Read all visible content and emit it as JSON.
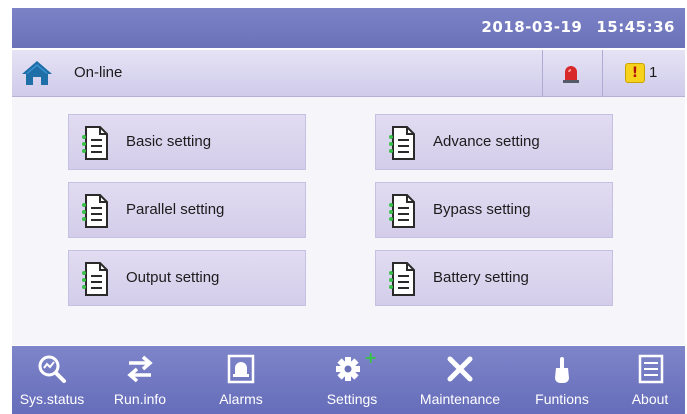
{
  "topbar": {
    "date": "2018-03-19",
    "time": "15:45:36"
  },
  "status": {
    "mode": "On-line",
    "warning_count": "1",
    "warning_symbol": "!"
  },
  "settings_menu": [
    {
      "label": "Basic setting"
    },
    {
      "label": "Advance setting"
    },
    {
      "label": "Parallel setting"
    },
    {
      "label": "Bypass setting"
    },
    {
      "label": "Output setting"
    },
    {
      "label": "Battery setting"
    }
  ],
  "bottom_nav": [
    {
      "label": "Sys.status",
      "icon": "magnifier-chart-icon"
    },
    {
      "label": "Run.info",
      "icon": "swap-arrows-icon"
    },
    {
      "label": "Alarms",
      "icon": "bell-icon"
    },
    {
      "label": "Settings",
      "icon": "gear-icon"
    },
    {
      "label": "Maintenance",
      "icon": "tools-icon"
    },
    {
      "label": "Funtions",
      "icon": "hand-pointer-icon"
    },
    {
      "label": "About",
      "icon": "document-icon"
    }
  ],
  "colors": {
    "topbar": "#6b72b8",
    "statusbar": "#d8d4ee",
    "menu_button": "#d8d2ee",
    "accent_green": "#39c24a",
    "alarm_red": "#d8282a",
    "warning_yellow": "#f7d21c"
  }
}
